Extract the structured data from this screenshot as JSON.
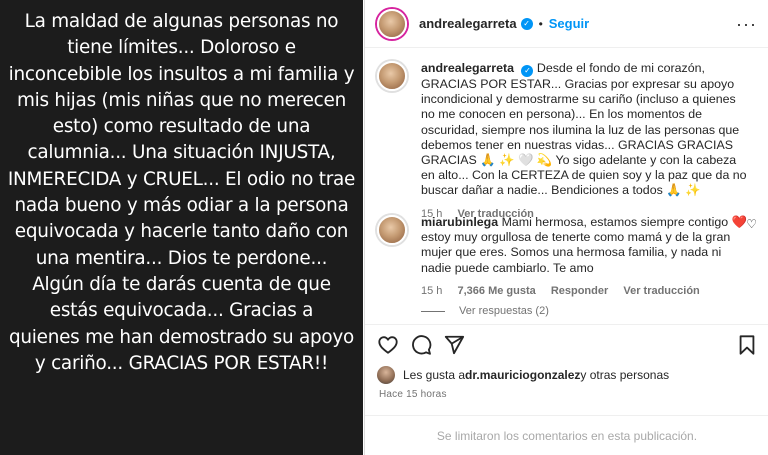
{
  "media": {
    "lines": [
      "La maldad de algunas personas no",
      "tiene límites... Doloroso e",
      "inconcebible los insultos a mi familia y",
      "mis hijas (mis niñas que no merecen",
      "esto) como resultado de una",
      "calumnia... Una situación INJUSTA,",
      "INMERECIDA y CRUEL... El odio no trae",
      "nada bueno y más odiar a la persona",
      "equivocada y hacerle tanto daño con",
      "una mentira... Dios te perdone...",
      "Algún día te darás cuenta de que",
      "estás equivocada... Gracias  a",
      "quienes me han demostrado su apoyo",
      "y cariño... GRACIAS POR ESTAR!!"
    ]
  },
  "header": {
    "username": "andrealegarreta",
    "separator": "•",
    "follow_label": "Seguir",
    "more_label": "···"
  },
  "caption": {
    "username": "andrealegarreta",
    "text": "Desde el fondo de mi corazón, GRACIAS POR ESTAR... Gracias por expresar su apoyo incondicional y demostrarme su cariño (incluso a quienes no me conocen en persona)... En los momentos de oscuridad, siempre nos ilumina la luz de las personas que debemos tener en nuestras vidas... GRACIAS GRACIAS GRACIAS 🙏 ✨ 🤍 💫 Yo sigo adelante y con la cabeza en alto... Con la CERTEZA de quien soy y la paz que da no buscar dañar a nadie... Bendiciones a todos 🙏 ✨",
    "time": "15 h",
    "translate": "Ver traducción"
  },
  "comment": {
    "username": "miarubinlega",
    "text": "Mami hermosa, estamos siempre contigo ❤️ estoy muy orgullosa de tenerte como mamá y de la gran mujer que eres. Somos una hermosa familia, y nada ni nadie puede cambiarlo. Te amo",
    "time": "15 h",
    "likes": "7,366 Me gusta",
    "reply": "Responder",
    "translate": "Ver traducción",
    "view_replies": "Ver respuestas (2)"
  },
  "likes": {
    "prefix": "Les gusta a ",
    "user": "dr.mauriciogonzalez",
    "suffix": " y otras personas"
  },
  "time_ago": "Hace 15 horas",
  "footer_text": "Se limitaron los comentarios en esta publicación.",
  "icons": {
    "heart": "heart-icon",
    "comment": "comment-icon",
    "share": "share-icon",
    "save": "bookmark-icon",
    "verified": "verified-badge-icon"
  },
  "colors": {
    "accent": "#0095f6",
    "muted": "#737373",
    "media_bg": "#1c1c1c"
  }
}
